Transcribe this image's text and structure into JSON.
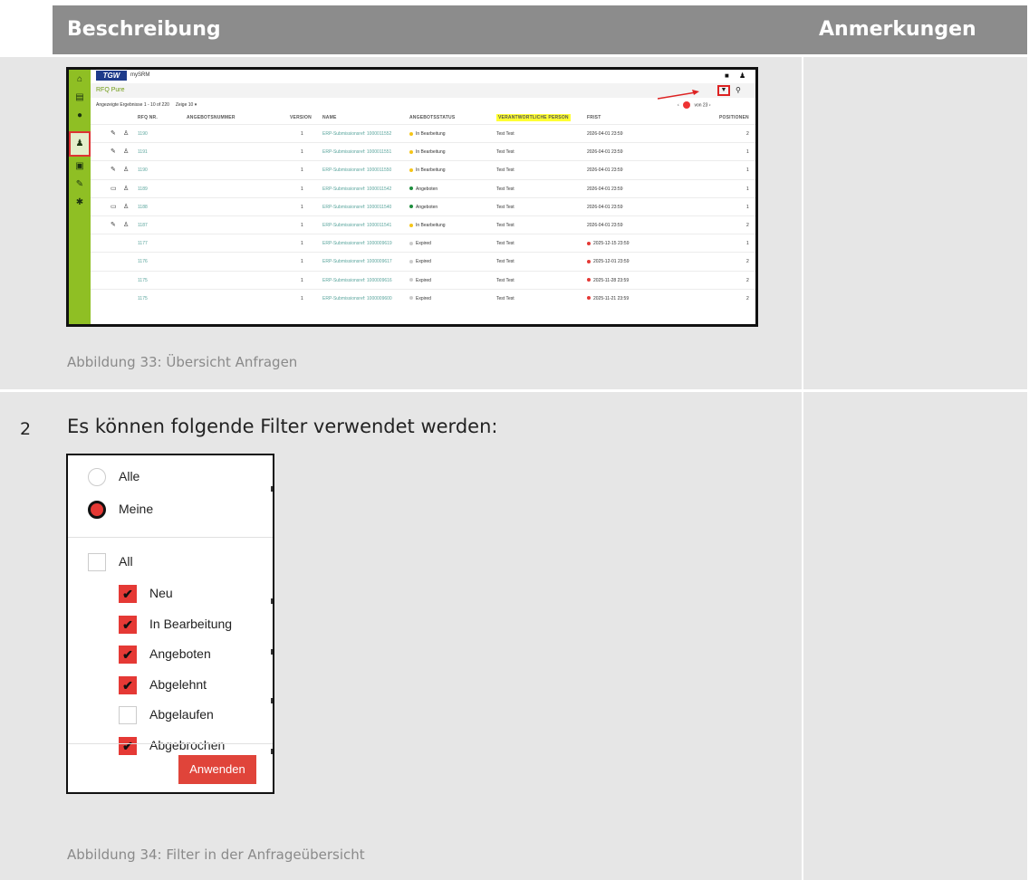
{
  "header": {
    "left": "Beschreibung",
    "right": "Anmerkungen"
  },
  "row1": {
    "caption": "Abbildung 33: Übersicht Anfragen",
    "screenshot": {
      "logo": "TGW",
      "app_name": "mySRM",
      "page_title": "RFQ Pure",
      "results_text": "Angezeigte Ergebnisse 1 - 10 of 220",
      "page_size_label": "Zeige",
      "page_size_value": "10",
      "pager_text": "von 23",
      "columns": [
        "RFQ NR.",
        "ANGEBOTSNUMMER",
        "VERSION",
        "NAME",
        "ANGEBOTSSTATUS",
        "VERANTWORTLICHE PERSON",
        "FRIST",
        "POSITIONEN"
      ],
      "highlight_column": "VERANTWORTLICHE PERSON",
      "rows": [
        {
          "icon": "✎",
          "nr": "1190",
          "version": "1",
          "name": "ERP-Submissionsref: 1000011552",
          "status": "In Bearbeitung",
          "status_color": "#f5c518",
          "person": "Test Test",
          "frist": "2026-04-01 23:59",
          "frist_alert": false,
          "pos": "2"
        },
        {
          "icon": "✎",
          "nr": "1191",
          "version": "1",
          "name": "ERP-Submissionsref: 1000011551",
          "status": "In Bearbeitung",
          "status_color": "#f5c518",
          "person": "Test Test",
          "frist": "2026-04-01 23:59",
          "frist_alert": false,
          "pos": "1"
        },
        {
          "icon": "✎",
          "nr": "1190",
          "version": "1",
          "name": "ERP-Submissionsref: 1000011550",
          "status": "In Bearbeitung",
          "status_color": "#f5c518",
          "person": "Test Test",
          "frist": "2026-04-01 23:59",
          "frist_alert": false,
          "pos": "1"
        },
        {
          "icon": "▭",
          "nr": "1189",
          "version": "1",
          "name": "ERP-Submissionsref: 1000011542",
          "status": "Angeboten",
          "status_color": "#1e8e3e",
          "person": "Test Test",
          "frist": "2026-04-01 23:59",
          "frist_alert": false,
          "pos": "1"
        },
        {
          "icon": "▭",
          "nr": "1188",
          "version": "1",
          "name": "ERP-Submissionsref: 1000011540",
          "status": "Angeboten",
          "status_color": "#1e8e3e",
          "person": "Test Test",
          "frist": "2026-04-01 23:59",
          "frist_alert": false,
          "pos": "1"
        },
        {
          "icon": "✎",
          "nr": "1187",
          "version": "1",
          "name": "ERP-Submissionsref: 1000011541",
          "status": "In Bearbeitung",
          "status_color": "#f5c518",
          "person": "Test Test",
          "frist": "2026-04-01 23:59",
          "frist_alert": false,
          "pos": "2"
        },
        {
          "icon": "",
          "nr": "1177",
          "version": "1",
          "name": "ERP-Submissionsref: 1000009619",
          "status": "Expired",
          "status_color": "#cccccc",
          "person": "Test Test",
          "frist": "2025-12-15 23:59",
          "frist_alert": true,
          "pos": "1"
        },
        {
          "icon": "",
          "nr": "1176",
          "version": "1",
          "name": "ERP-Submissionsref: 1000009617",
          "status": "Expired",
          "status_color": "#cccccc",
          "person": "Test Test",
          "frist": "2025-12-01 23:59",
          "frist_alert": true,
          "pos": "2"
        },
        {
          "icon": "",
          "nr": "1175",
          "version": "1",
          "name": "ERP-Submissionsref: 1000009616",
          "status": "Expired",
          "status_color": "#cccccc",
          "person": "Test Test",
          "frist": "2025-11-28 23:59",
          "frist_alert": true,
          "pos": "2"
        },
        {
          "icon": "",
          "nr": "1175",
          "version": "1",
          "name": "ERP-Submissionsref: 1000009600",
          "status": "Expired",
          "status_color": "#cccccc",
          "person": "Test Test",
          "frist": "2025-11-21 23:59",
          "frist_alert": true,
          "pos": "2"
        }
      ]
    }
  },
  "row2": {
    "number": "2",
    "intro": "Es können folgende Filter verwendet werden:",
    "caption": "Abbildung 34: Filter in der Anfrageübersicht",
    "filter": {
      "radio_all": "Alle",
      "radio_mine": "Meine",
      "check_all": "All",
      "statuses": [
        {
          "label": "Neu",
          "checked": true
        },
        {
          "label": "In Bearbeitung",
          "checked": true
        },
        {
          "label": "Angeboten",
          "checked": true
        },
        {
          "label": "Abgelehnt",
          "checked": true
        },
        {
          "label": "Abgelaufen",
          "checked": false
        },
        {
          "label": "Abgebrochen",
          "checked": true
        }
      ],
      "apply_label": "Anwenden"
    }
  },
  "colors": {
    "header_bg": "#8c8c8c",
    "cell_bg": "#e6e6e6",
    "sidebar_green": "#8fbf24",
    "accent_red": "#e53935"
  }
}
